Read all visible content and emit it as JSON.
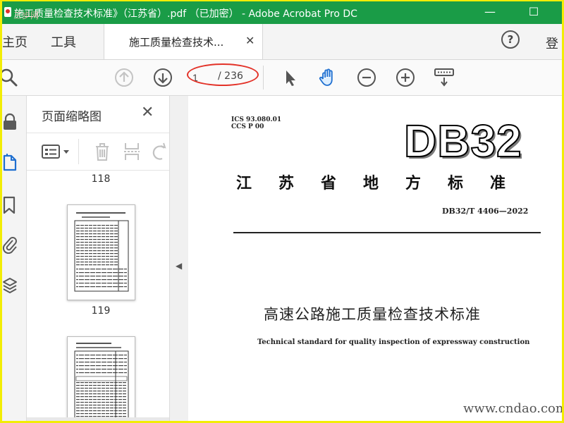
{
  "window": {
    "title": "施工质量检查技术标准》（江苏省）.pdf （已加密） - Adobe Acrobat Pro DC",
    "watermark": "三步网",
    "buttons": {
      "minimize": "—",
      "maximize": "☐"
    }
  },
  "tabs": {
    "home": "主页",
    "tools": "工具",
    "document": "施工质量检查技术...",
    "close": "✕",
    "help": "?",
    "login": "登"
  },
  "toolbar": {
    "current_page": "1",
    "page_total": "/ 236"
  },
  "panel": {
    "title": "页面缩略图",
    "close": "✕",
    "thumbnails": [
      {
        "label": "118"
      },
      {
        "label": "119"
      }
    ]
  },
  "document": {
    "ics": "ICS 93.080.01",
    "ccs": "CCS P 00",
    "db_logo": "DB32",
    "province_standard": "江苏省地方标准",
    "standard_code": "DB32/T 4406—2022",
    "title_cn": "高速公路施工质量检查技术标准",
    "title_en": "Technical standard for quality inspection of expressway construction",
    "site_watermark": "www.cndao.com"
  },
  "colors": {
    "titlebar": "#1a9c47",
    "outer_border": "#f2ed05",
    "annotation": "#e33228",
    "hand_tool": "#1f6fd0"
  }
}
